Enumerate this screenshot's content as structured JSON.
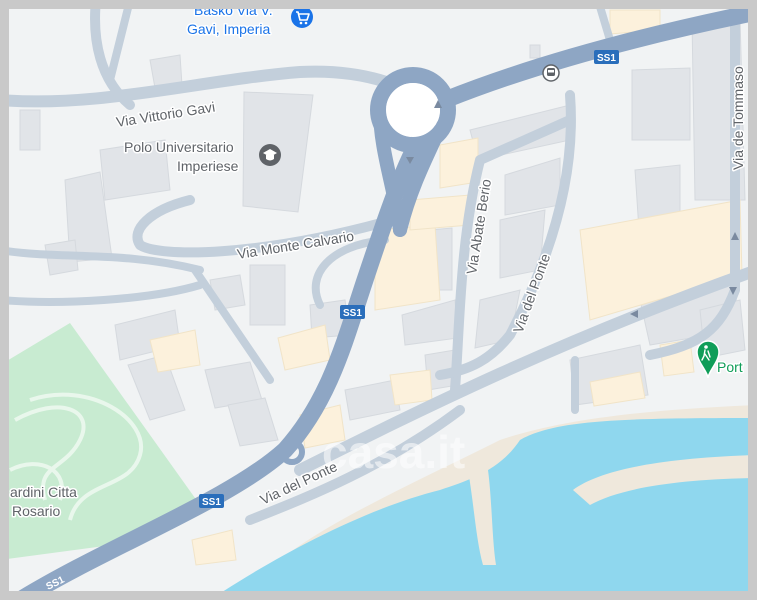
{
  "map": {
    "watermark": "casa.it",
    "colors": {
      "background": "#f1f3f4",
      "building": "#e1e4e8",
      "building_warm": "#fcf1dc",
      "park": "#c8ebd1",
      "water": "#8fd7ee",
      "beach": "#efe8dc",
      "minor_road": "#c3cfdb",
      "major_road": "#8ea6c4",
      "shield": "#2a6ebb",
      "poi_blue": "#1a73e8",
      "poi_green": "#0f9d58",
      "poi_gray": "#5f6368"
    },
    "streets": {
      "vittorio_gavi": "Via Vittorio Gavi",
      "monte_calvario": "Via Monte Calvario",
      "abate_berio": "Via Abate Berio",
      "del_ponte_vertical": "Via del Ponte",
      "del_ponte_bottom": "Via del Ponte",
      "de_tommaso": "Via de Tommaso"
    },
    "shields": {
      "ss1_top": "SS1",
      "ss1_mid": "SS1",
      "ss1_low": "SS1",
      "ss1_bottom": "SS1"
    },
    "pois": {
      "basko_line1": "Basko Via V.",
      "basko_line2": "Gavi, Imperia",
      "polo_line1": "Polo Universitario",
      "polo_line2": "Imperiese",
      "giardini_line1": "ardini Citta",
      "giardini_line2": "i Rosario",
      "port_label": "Port"
    },
    "icons": {
      "basko": "shopping-cart-icon",
      "polo": "graduation-cap-icon",
      "port": "hiking-icon",
      "bus": "bus-stop-icon"
    }
  }
}
